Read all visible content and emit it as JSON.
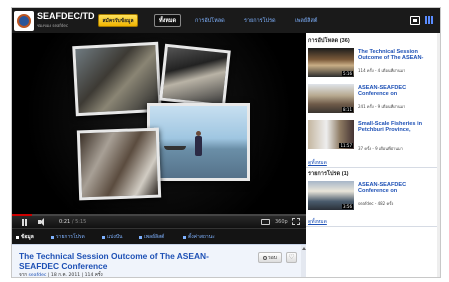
{
  "header": {
    "channel_name": "SEAFDEC/TD",
    "channel_sub": "ช่องของ seafdec",
    "subscribe_label": "สมัครรับข้อมูล",
    "tabs": [
      {
        "label": "ทั้งหมด",
        "active": true
      },
      {
        "label": "การอัปโหลด",
        "active": false
      },
      {
        "label": "รายการโปรด",
        "active": false
      },
      {
        "label": "เพลย์ลิสต์",
        "active": false
      }
    ],
    "view_icons": [
      "player-view-icon",
      "grid-view-icon"
    ]
  },
  "player": {
    "current_time": "0:21",
    "total_time": "/ 5:15",
    "quality": "360p",
    "progress_fraction": 0.067,
    "state": "playing"
  },
  "video_tabs": [
    {
      "label": "ข้อมูล",
      "active": true
    },
    {
      "label": "รายการโปรด",
      "active": false
    },
    {
      "label": "แบ่งปัน",
      "active": false
    },
    {
      "label": "เพลย์ลิสต์",
      "active": false
    },
    {
      "label": "ตั้งค่าสถานะ",
      "active": false
    }
  ],
  "info": {
    "title": "The Technical Session Outcome of The ASEAN-SEAFDEC Conference",
    "meta_prefix": "จาก",
    "meta_channel": "seafdec",
    "meta_rest": "| 18 ก.ค. 2011 | 114 ครั้ง",
    "share_label": "รอบ"
  },
  "sidebar": {
    "uploads_header": "การอัปโหลด (36)",
    "uploads": [
      {
        "title": "The Technical Session Outcome of The ASEAN-",
        "meta": "114 ครั้ง - 4 เดือนที่ผ่านมา",
        "duration": "5:16",
        "icon": "video-thumbnail"
      },
      {
        "title": "ASEAN-SEAFDEC Conference on",
        "meta": "241 ครั้ง - 9 เดือนที่ผ่านมา",
        "duration": "8:11",
        "icon": "video-thumbnail"
      },
      {
        "title": "Small-Scale Fisheries in Petchburi Province,",
        "meta": "37 ครั้ง - 9 เดือนที่ผ่านมา",
        "duration": "11:57",
        "icon": "video-thumbnail"
      }
    ],
    "uploads_more": "ดูทั้งหมด",
    "favorites_header": "รายการโปรด (1)",
    "favorites": [
      {
        "title": "ASEAN-SEAFDEC Conference on",
        "meta": "seafdec - 482 ครั้ง",
        "duration": "3:56",
        "icon": "video-thumbnail"
      }
    ],
    "favorites_more": "ดูทั้งหมด"
  }
}
